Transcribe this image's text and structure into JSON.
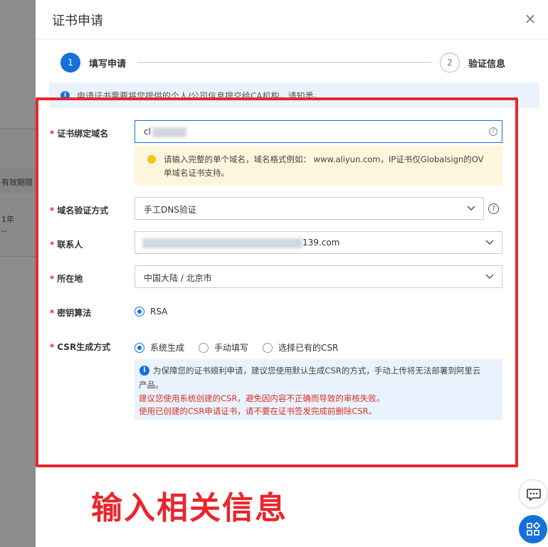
{
  "background": {
    "column_header": "有效期限",
    "row_value": "1年",
    "row_dash": "--"
  },
  "modal": {
    "title": "证书申请",
    "close": "×"
  },
  "steps": [
    {
      "number": "1",
      "label": "填写申请"
    },
    {
      "number": "2",
      "label": "验证信息"
    }
  ],
  "info_banner": "申请证书需要将您提供的个人/公司信息提交给CA机构，请知悉。",
  "form": {
    "domain": {
      "label": "证书绑定域名",
      "value": "cl",
      "tip": "请输入完整的单个域名，域名格式例如： www.aliyun.com，IP证书仅Globalsign的OV单域名证书支持。"
    },
    "verify_method": {
      "label": "域名验证方式",
      "value": "手工DNS验证"
    },
    "contact": {
      "label": "联系人",
      "value": "139.com"
    },
    "location": {
      "label": "所在地",
      "value": "中国大陆 / 北京市"
    },
    "key_algorithm": {
      "label": "密钥算法",
      "options": [
        "RSA"
      ]
    },
    "csr": {
      "label": "CSR生成方式",
      "options": [
        "系统生成",
        "手动填写",
        "选择已有的CSR"
      ],
      "notice_line1": "为保障您的证书顺利申请，建议您使用默认生成CSR的方式，手动上传将无法部署到阿里云",
      "notice_line2": "产品。",
      "warning_line1": "建议您使用系统创建的CSR，避免因内容不正确而导致的审核失败。",
      "warning_line2": "使用已创建的CSR申请证书，请不要在证书签发完成前删除CSR。"
    }
  },
  "annotation": {
    "caption": "输入相关信息"
  },
  "colors": {
    "primary": "#1570d8",
    "annotation": "#e8262d",
    "tip_bg": "#fdf6dc",
    "info_bg": "#eaf3fd"
  }
}
